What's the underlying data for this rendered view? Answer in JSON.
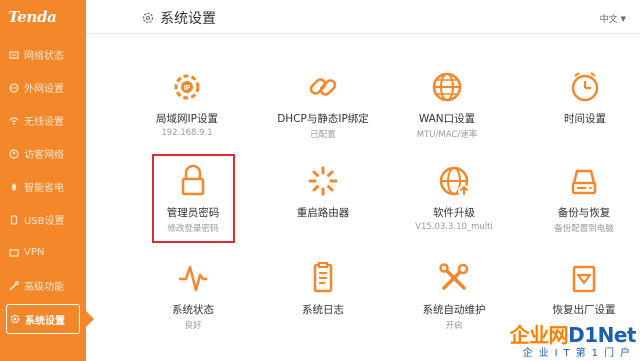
{
  "brand": {
    "logo_text": "Tenda"
  },
  "header": {
    "title": "系统设置",
    "language": "中文"
  },
  "sidebar": {
    "items": [
      {
        "label": "网络状态",
        "icon": "network-status-icon"
      },
      {
        "label": "外网设置",
        "icon": "globe-icon"
      },
      {
        "label": "无线设置",
        "icon": "wifi-icon"
      },
      {
        "label": "访客网络",
        "icon": "guest-icon"
      },
      {
        "label": "智能省电",
        "icon": "power-save-icon"
      },
      {
        "label": "USB设置",
        "icon": "usb-icon"
      },
      {
        "label": "VPN",
        "icon": "vpn-icon"
      },
      {
        "label": "高级功能",
        "icon": "tools-icon"
      },
      {
        "label": "系统设置",
        "icon": "gear-icon",
        "active": true
      }
    ]
  },
  "tiles": [
    {
      "label": "局域网IP设置",
      "sub": "192.168.9.1",
      "icon": "lan-ip-icon"
    },
    {
      "label": "DHCP与静态IP绑定",
      "sub": "已配置",
      "icon": "link-icon"
    },
    {
      "label": "WAN口设置",
      "sub": "MTU/MAC/速率",
      "icon": "globe-icon"
    },
    {
      "label": "时间设置",
      "sub": "",
      "icon": "clock-icon"
    },
    {
      "label": "管理员密码",
      "sub": "修改登录密码",
      "icon": "lock-icon"
    },
    {
      "label": "重启路由器",
      "sub": "",
      "icon": "restart-icon"
    },
    {
      "label": "软件升级",
      "sub": "V15.03.3.10_multi",
      "icon": "upgrade-icon"
    },
    {
      "label": "备份与恢复",
      "sub": "备份配置到电脑",
      "icon": "backup-icon"
    },
    {
      "label": "系统状态",
      "sub": "良好",
      "icon": "pulse-icon"
    },
    {
      "label": "系统日志",
      "sub": "",
      "icon": "log-icon"
    },
    {
      "label": "系统自动维护",
      "sub": "开启",
      "icon": "maintenance-icon"
    },
    {
      "label": "恢复出厂设置",
      "sub": "",
      "icon": "factory-reset-icon"
    }
  ],
  "watermark": {
    "main_a": "企业网",
    "main_b": "D1Net",
    "sub": "企业IT第1门户"
  },
  "colors": {
    "accent": "#f5872b",
    "highlight": "#e0282e"
  }
}
